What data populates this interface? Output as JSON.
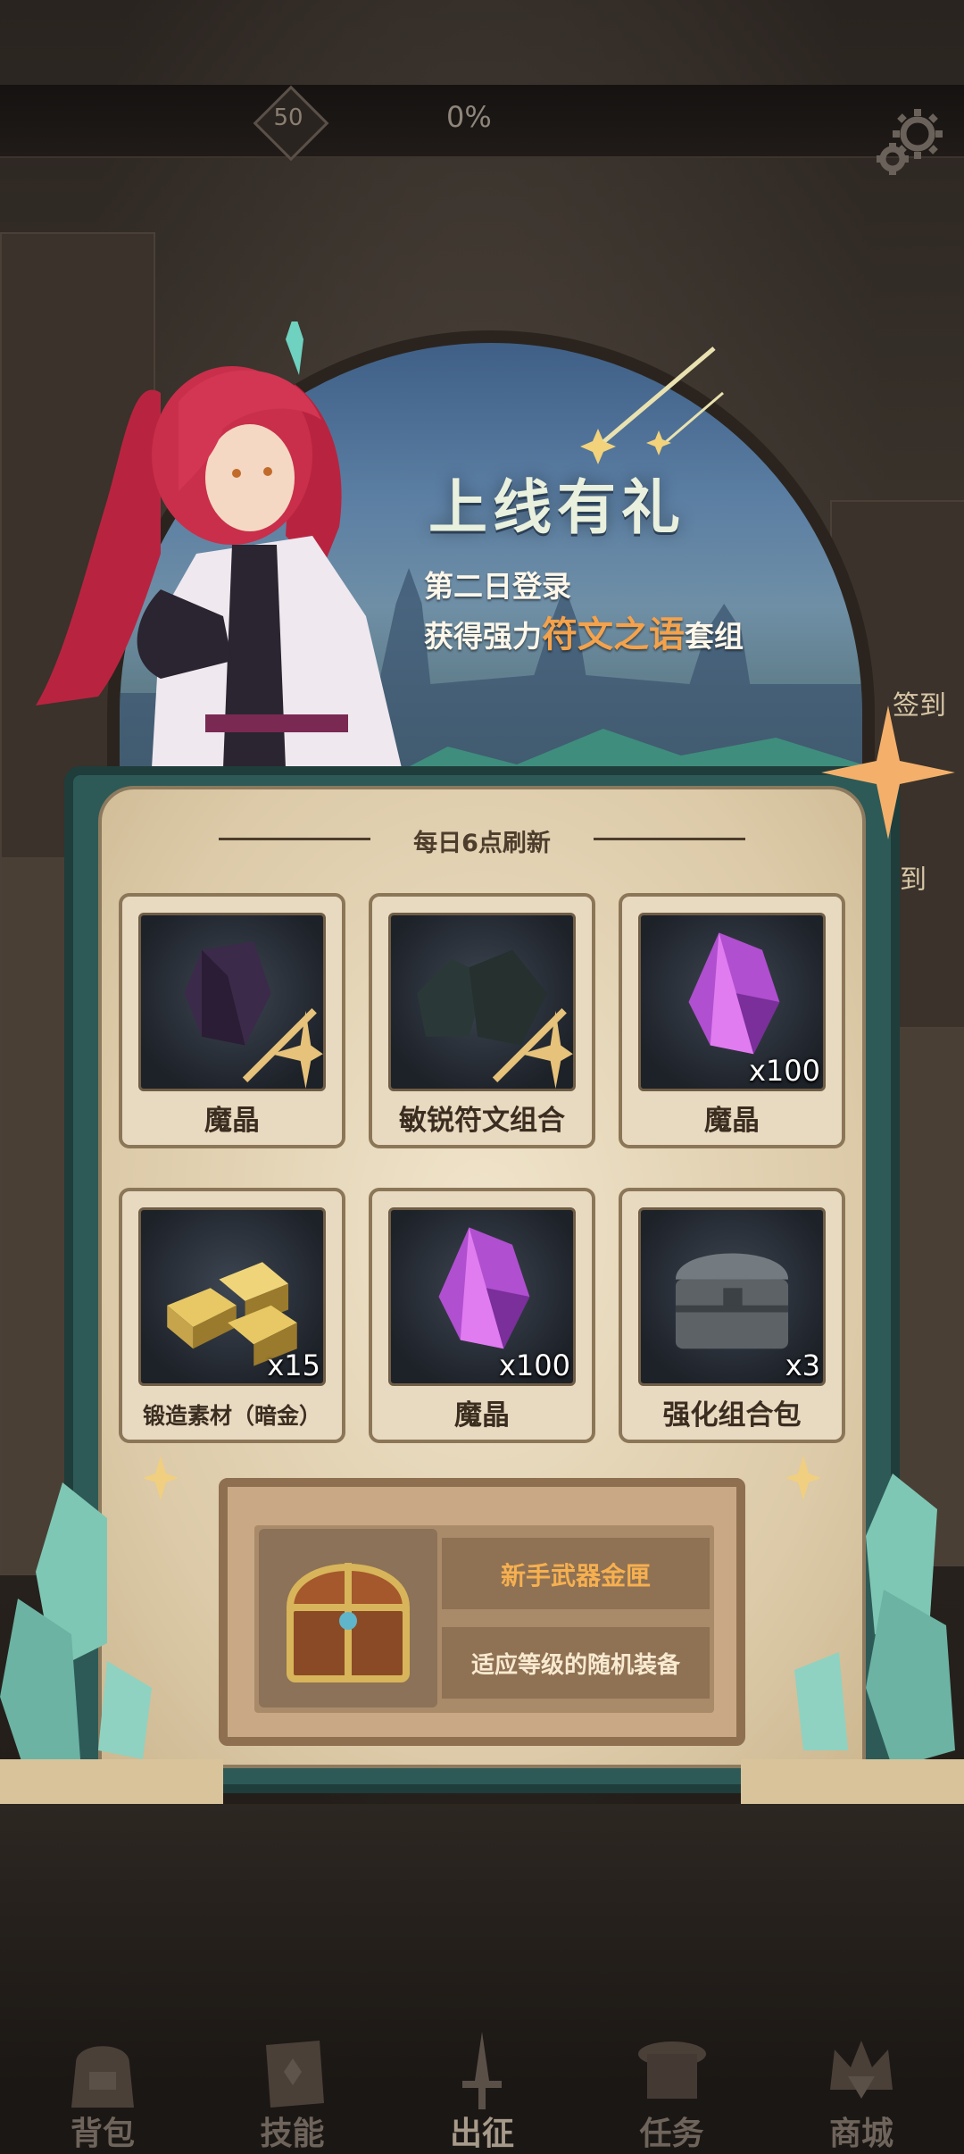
{
  "topbar": {
    "level": "50",
    "progress": "0%"
  },
  "banner": {
    "title": "上线有礼",
    "line1": "第二日登录",
    "line2_prefix": "获得强力",
    "line2_highlight": "符文之语",
    "line2_suffix": "套组",
    "side_sign_1": "签到",
    "side_sign_2": "到"
  },
  "panel": {
    "refresh": "每日6点刷新",
    "items": [
      {
        "name": "魔晶",
        "qty": "",
        "icon": "dark-crystal-icon"
      },
      {
        "name": "敏锐符文组合",
        "qty": "",
        "icon": "rune-stone-icon"
      },
      {
        "name": "魔晶",
        "qty": "x100",
        "icon": "purple-crystal-icon"
      },
      {
        "name": "锻造素材（暗金）",
        "qty": "x15",
        "icon": "gold-ingot-icon"
      },
      {
        "name": "魔晶",
        "qty": "x100",
        "icon": "purple-crystal-icon"
      },
      {
        "name": "强化组合包",
        "qty": "x3",
        "icon": "iron-chest-icon"
      }
    ],
    "reward": {
      "name": "新手武器金匣",
      "desc": "适应等级的随机装备",
      "icon": "golden-chest-icon"
    }
  },
  "nav": [
    {
      "label": "背包",
      "icon": "backpack-icon"
    },
    {
      "label": "技能",
      "icon": "skill-book-icon"
    },
    {
      "label": "出征",
      "icon": "sword-icon"
    },
    {
      "label": "任务",
      "icon": "scroll-icon"
    },
    {
      "label": "商城",
      "icon": "shop-crown-icon"
    }
  ],
  "colors": {
    "accent_orange": "#f4a24b",
    "panel_teal": "#2d5a57",
    "parchment": "#e8dac0"
  }
}
